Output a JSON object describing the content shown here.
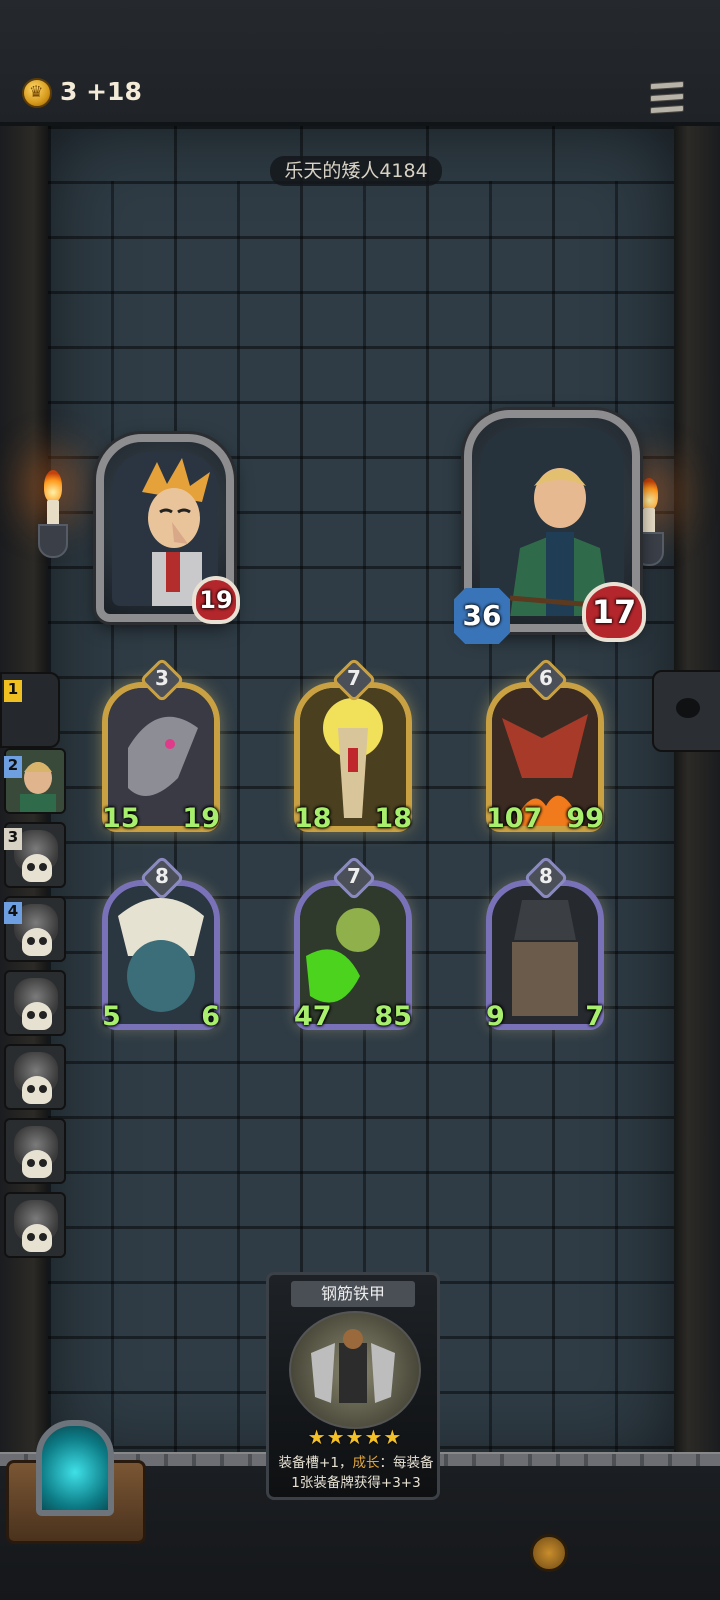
{
  "header": {
    "gold_text": "3 +18",
    "coin_icon": "crown-coin-icon",
    "menu_icon": "menu-icon"
  },
  "opponent": {
    "name": "乐天的矮人4184",
    "hero_health": "19"
  },
  "player": {
    "hero_armor": "36",
    "hero_health": "17"
  },
  "board": [
    {
      "cost": "3",
      "attack": "15",
      "health": "19",
      "frame": "gold"
    },
    {
      "cost": "7",
      "attack": "18",
      "health": "18",
      "frame": "gold"
    },
    {
      "cost": "6",
      "attack": "107",
      "health": "99",
      "frame": "gold"
    },
    {
      "cost": "8",
      "attack": "5",
      "health": "6",
      "frame": "purple"
    },
    {
      "cost": "7",
      "attack": "47",
      "health": "85",
      "frame": "purple"
    },
    {
      "cost": "8",
      "attack": "9",
      "health": "7",
      "frame": "purple"
    }
  ],
  "timeline": [
    {
      "num": "1",
      "color": "#f0c020"
    },
    {
      "num": "2",
      "color": "#6e9fe0"
    },
    {
      "num": "3",
      "color": "#d8d2c4"
    },
    {
      "num": "4",
      "color": "#6e9fe0"
    }
  ],
  "equipment": {
    "title": "钢筋铁甲",
    "stars": "★★★★★",
    "desc_part1": "装备槽+1，",
    "desc_highlight": "成长",
    "desc_part2": "：每装备1张装备牌获得+3+3"
  },
  "colors": {
    "gold_frame": "#c9a143",
    "purple_frame": "#7a72b8",
    "stat_green": "#a7ef6c",
    "heart_red": "#b3262c",
    "armor_blue": "#3a74b8"
  }
}
